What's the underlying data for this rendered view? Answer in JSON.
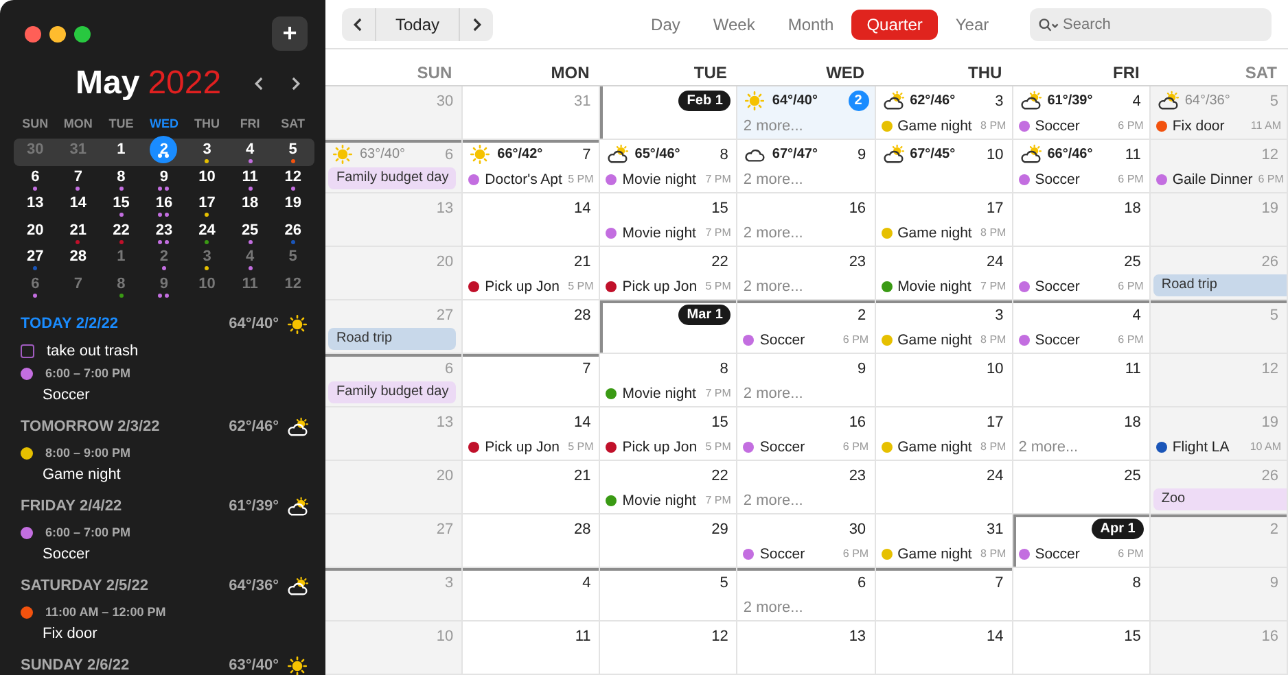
{
  "sidebar": {
    "add_button": "+",
    "month": "May",
    "year": "2022",
    "weekdays": [
      {
        "label": "SUN",
        "selected": false
      },
      {
        "label": "MON",
        "selected": false
      },
      {
        "label": "TUE",
        "selected": false
      },
      {
        "label": "WED",
        "selected": true
      },
      {
        "label": "THU",
        "selected": false
      },
      {
        "label": "FRI",
        "selected": false
      },
      {
        "label": "SAT",
        "selected": false
      }
    ],
    "weeks": [
      {
        "selected": true,
        "days": [
          {
            "day": "30",
            "dim": true,
            "selected": false
          },
          {
            "day": "31",
            "dim": true,
            "selected": false
          },
          {
            "day": "1",
            "dim": false,
            "selected": false
          },
          {
            "day": "2",
            "dim": false,
            "selected": true,
            "dots": [
              {
                "color": "#ffffff"
              },
              {
                "color": "#ffffff"
              }
            ]
          },
          {
            "day": "3",
            "dim": false,
            "selected": false,
            "dots": [
              {
                "color": "#e6c000"
              }
            ]
          },
          {
            "day": "4",
            "dim": false,
            "selected": false,
            "dots": [
              {
                "color": "#c36ee0"
              }
            ]
          },
          {
            "day": "5",
            "dim": false,
            "selected": false,
            "dots": [
              {
                "color": "#f2520e"
              }
            ]
          }
        ]
      },
      {
        "selected": false,
        "days": [
          {
            "day": "6",
            "dim": false,
            "selected": false,
            "dots": [
              {
                "color": "#c36ee0"
              }
            ]
          },
          {
            "day": "7",
            "dim": false,
            "selected": false,
            "dots": [
              {
                "color": "#c36ee0"
              }
            ]
          },
          {
            "day": "8",
            "dim": false,
            "selected": false,
            "dots": [
              {
                "color": "#c36ee0"
              }
            ]
          },
          {
            "day": "9",
            "dim": false,
            "selected": false,
            "dots": [
              {
                "color": "#c36ee0"
              },
              {
                "color": "#c36ee0"
              }
            ]
          },
          {
            "day": "10",
            "dim": false,
            "selected": false
          },
          {
            "day": "11",
            "dim": false,
            "selected": false,
            "dots": [
              {
                "color": "#c36ee0"
              }
            ]
          },
          {
            "day": "12",
            "dim": false,
            "selected": false,
            "dots": [
              {
                "color": "#c36ee0"
              }
            ]
          }
        ]
      },
      {
        "selected": false,
        "days": [
          {
            "day": "13",
            "dim": false,
            "selected": false
          },
          {
            "day": "14",
            "dim": false,
            "selected": false
          },
          {
            "day": "15",
            "dim": false,
            "selected": false,
            "dots": [
              {
                "color": "#c36ee0"
              }
            ]
          },
          {
            "day": "16",
            "dim": false,
            "selected": false,
            "dots": [
              {
                "color": "#c36ee0"
              },
              {
                "color": "#c36ee0"
              }
            ]
          },
          {
            "day": "17",
            "dim": false,
            "selected": false,
            "dots": [
              {
                "color": "#e6c000"
              }
            ]
          },
          {
            "day": "18",
            "dim": false,
            "selected": false
          },
          {
            "day": "19",
            "dim": false,
            "selected": false
          }
        ]
      },
      {
        "selected": false,
        "days": [
          {
            "day": "20",
            "dim": false,
            "selected": false
          },
          {
            "day": "21",
            "dim": false,
            "selected": false,
            "dots": [
              {
                "color": "#c0102a"
              }
            ]
          },
          {
            "day": "22",
            "dim": false,
            "selected": false,
            "dots": [
              {
                "color": "#c0102a"
              }
            ]
          },
          {
            "day": "23",
            "dim": false,
            "selected": false,
            "dots": [
              {
                "color": "#c36ee0"
              },
              {
                "color": "#c36ee0"
              }
            ]
          },
          {
            "day": "24",
            "dim": false,
            "selected": false,
            "dots": [
              {
                "color": "#3a9a14"
              }
            ]
          },
          {
            "day": "25",
            "dim": false,
            "selected": false,
            "dots": [
              {
                "color": "#c36ee0"
              }
            ]
          },
          {
            "day": "26",
            "dim": false,
            "selected": false,
            "dots": [
              {
                "color": "#1a55b8"
              }
            ]
          }
        ]
      },
      {
        "selected": false,
        "days": [
          {
            "day": "27",
            "dim": false,
            "selected": false,
            "dots": [
              {
                "color": "#1a55b8"
              }
            ]
          },
          {
            "day": "28",
            "dim": false,
            "selected": false
          },
          {
            "day": "1",
            "dim": true,
            "selected": false
          },
          {
            "day": "2",
            "dim": true,
            "selected": false,
            "dots": [
              {
                "color": "#c36ee0"
              }
            ]
          },
          {
            "day": "3",
            "dim": true,
            "selected": false,
            "dots": [
              {
                "color": "#e6c000"
              }
            ]
          },
          {
            "day": "4",
            "dim": true,
            "selected": false,
            "dots": [
              {
                "color": "#c36ee0"
              }
            ]
          },
          {
            "day": "5",
            "dim": true,
            "selected": false
          }
        ]
      },
      {
        "selected": false,
        "days": [
          {
            "day": "6",
            "dim": true,
            "selected": false,
            "dots": [
              {
                "color": "#c36ee0"
              }
            ]
          },
          {
            "day": "7",
            "dim": true,
            "selected": false
          },
          {
            "day": "8",
            "dim": true,
            "selected": false,
            "dots": [
              {
                "color": "#3a9a14"
              }
            ]
          },
          {
            "day": "9",
            "dim": true,
            "selected": false,
            "dots": [
              {
                "color": "#c36ee0"
              },
              {
                "color": "#c36ee0"
              }
            ]
          },
          {
            "day": "10",
            "dim": true,
            "selected": false
          },
          {
            "day": "11",
            "dim": true,
            "selected": false
          },
          {
            "day": "12",
            "dim": true,
            "selected": false
          }
        ]
      }
    ],
    "agenda": [
      {
        "label": "TODAY",
        "date": "2/2/22",
        "today": true,
        "weather": {
          "kind": "sun",
          "temp": "64°/40°"
        },
        "items": [
          {
            "kind": "task",
            "title": "take out trash",
            "checked": false
          },
          {
            "kind": "event",
            "time": "6:00 – 7:00 PM",
            "title": "Soccer",
            "color": "#c36ee0"
          }
        ]
      },
      {
        "label": "TOMORROW",
        "date": "2/3/22",
        "today": false,
        "weather": {
          "kind": "cloud-sun",
          "temp": "62°/46°"
        },
        "items": [
          {
            "kind": "event",
            "time": "8:00 – 9:00 PM",
            "title": "Game night",
            "color": "#e6c000"
          }
        ]
      },
      {
        "label": "FRIDAY",
        "date": "2/4/22",
        "today": false,
        "weather": {
          "kind": "cloud-sun",
          "temp": "61°/39°"
        },
        "items": [
          {
            "kind": "event",
            "time": "6:00 – 7:00 PM",
            "title": "Soccer",
            "color": "#c36ee0"
          }
        ]
      },
      {
        "label": "SATURDAY",
        "date": "2/5/22",
        "today": false,
        "weather": {
          "kind": "cloud-sun",
          "temp": "64°/36°"
        },
        "items": [
          {
            "kind": "event",
            "time": "11:00 AM – 12:00 PM",
            "title": "Fix door",
            "color": "#f2520e"
          }
        ]
      },
      {
        "label": "SUNDAY",
        "date": "2/6/22",
        "today": false,
        "weather": {
          "kind": "sun",
          "temp": "63°/40°"
        }
      }
    ]
  },
  "toolbar": {
    "today_button": "Today",
    "views": [
      {
        "label": "Day",
        "selected": false
      },
      {
        "label": "Week",
        "selected": false
      },
      {
        "label": "Month",
        "selected": false
      },
      {
        "label": "Quarter",
        "selected": true
      },
      {
        "label": "Year",
        "selected": false
      }
    ],
    "search": {
      "placeholder": "Search"
    }
  },
  "calendar": {
    "weekdays": [
      "SUN",
      "MON",
      "TUE",
      "WED",
      "THU",
      "FRI",
      "SAT"
    ],
    "weeks": [
      [
        {
          "day": "30",
          "dimmed": true
        },
        {
          "day": "31",
          "dimmed": true
        },
        {
          "badge": "Feb 1"
        },
        {
          "day": "2",
          "today": true,
          "weather": {
            "kind": "sun",
            "temp": "64°/40°"
          },
          "events": [
            {
              "kind": "more",
              "title": "2 more..."
            }
          ]
        },
        {
          "day": "3",
          "weather": {
            "kind": "cloud-sun",
            "temp": "62°/46°"
          },
          "events": [
            {
              "kind": "timed",
              "title": "Game night",
              "time": "8 PM",
              "color": "#e6c000"
            }
          ]
        },
        {
          "day": "4",
          "weather": {
            "kind": "cloud-sun",
            "temp": "61°/39°"
          },
          "events": [
            {
              "kind": "timed",
              "title": "Soccer",
              "time": "6 PM",
              "color": "#c36ee0"
            }
          ]
        },
        {
          "day": "5",
          "weather": {
            "kind": "cloud-sun",
            "temp": "64°/36°"
          },
          "events": [
            {
              "kind": "timed",
              "title": "Fix door",
              "time": "11 AM",
              "color": "#f2520e"
            }
          ]
        }
      ],
      [
        {
          "day": "6",
          "weather": {
            "kind": "sun",
            "temp": "63°/40°"
          },
          "events": [
            {
              "kind": "allday",
              "title": "Family budget day",
              "color": "#ecdaf5"
            }
          ]
        },
        {
          "day": "7",
          "weather": {
            "kind": "sun",
            "temp": "66°/42°"
          },
          "events": [
            {
              "kind": "timed",
              "title": "Doctor's Apt",
              "time": "5 PM",
              "color": "#c36ee0"
            }
          ]
        },
        {
          "day": "8",
          "weather": {
            "kind": "cloud-sun",
            "temp": "65°/46°"
          },
          "events": [
            {
              "kind": "timed",
              "title": "Movie night",
              "time": "7 PM",
              "color": "#c36ee0"
            }
          ]
        },
        {
          "day": "9",
          "weather": {
            "kind": "cloud",
            "temp": "67°/47°"
          },
          "events": [
            {
              "kind": "more",
              "title": "2 more..."
            }
          ]
        },
        {
          "day": "10",
          "weather": {
            "kind": "cloud-sun",
            "temp": "67°/45°"
          }
        },
        {
          "day": "11",
          "weather": {
            "kind": "cloud-sun",
            "temp": "66°/46°"
          },
          "events": [
            {
              "kind": "timed",
              "title": "Soccer",
              "time": "6 PM",
              "color": "#c36ee0"
            }
          ]
        },
        {
          "day": "12",
          "events": [
            {
              "kind": "timed",
              "title": "Gaile Dinner",
              "time": "6 PM",
              "color": "#c36ee0"
            }
          ]
        }
      ],
      [
        {
          "day": "13"
        },
        {
          "day": "14"
        },
        {
          "day": "15",
          "events": [
            {
              "kind": "timed",
              "title": "Movie night",
              "time": "7 PM",
              "color": "#c36ee0"
            }
          ]
        },
        {
          "day": "16",
          "events": [
            {
              "kind": "more",
              "title": "2 more..."
            }
          ]
        },
        {
          "day": "17",
          "events": [
            {
              "kind": "timed",
              "title": "Game night",
              "time": "8 PM",
              "color": "#e6c000"
            }
          ]
        },
        {
          "day": "18"
        },
        {
          "day": "19"
        }
      ],
      [
        {
          "day": "20"
        },
        {
          "day": "21",
          "events": [
            {
              "kind": "timed",
              "title": "Pick up Jon",
              "time": "5 PM",
              "color": "#c0102a"
            }
          ]
        },
        {
          "day": "22",
          "events": [
            {
              "kind": "timed",
              "title": "Pick up Jon",
              "time": "5 PM",
              "color": "#c0102a"
            }
          ]
        },
        {
          "day": "23",
          "events": [
            {
              "kind": "more",
              "title": "2 more..."
            }
          ]
        },
        {
          "day": "24",
          "events": [
            {
              "kind": "timed",
              "title": "Movie night",
              "time": "7 PM",
              "color": "#3a9a14"
            }
          ]
        },
        {
          "day": "25",
          "events": [
            {
              "kind": "timed",
              "title": "Soccer",
              "time": "6 PM",
              "color": "#c36ee0"
            }
          ]
        },
        {
          "day": "26",
          "events": [
            {
              "kind": "allday",
              "title": "Road trip",
              "color": "#c8d8ea"
            }
          ]
        }
      ],
      [
        {
          "day": "27",
          "events": [
            {
              "kind": "allday",
              "title": "Road trip",
              "color": "#c8d8ea"
            }
          ]
        },
        {
          "day": "28"
        },
        {
          "badge": "Mar 1"
        },
        {
          "day": "2",
          "events": [
            {
              "kind": "timed",
              "title": "Soccer",
              "time": "6 PM",
              "color": "#c36ee0"
            }
          ]
        },
        {
          "day": "3",
          "events": [
            {
              "kind": "timed",
              "title": "Game night",
              "time": "8 PM",
              "color": "#e6c000"
            }
          ]
        },
        {
          "day": "4",
          "events": [
            {
              "kind": "timed",
              "title": "Soccer",
              "time": "6 PM",
              "color": "#c36ee0"
            }
          ]
        },
        {
          "day": "5"
        }
      ],
      [
        {
          "day": "6",
          "events": [
            {
              "kind": "allday",
              "title": "Family budget day",
              "color": "#ecdaf5"
            }
          ]
        },
        {
          "day": "7"
        },
        {
          "day": "8",
          "events": [
            {
              "kind": "timed",
              "title": "Movie night",
              "time": "7 PM",
              "color": "#3a9a14"
            }
          ]
        },
        {
          "day": "9",
          "events": [
            {
              "kind": "more",
              "title": "2 more..."
            }
          ]
        },
        {
          "day": "10"
        },
        {
          "day": "11"
        },
        {
          "day": "12"
        }
      ],
      [
        {
          "day": "13"
        },
        {
          "day": "14",
          "events": [
            {
              "kind": "timed",
              "title": "Pick up Jon",
              "time": "5 PM",
              "color": "#c0102a"
            }
          ]
        },
        {
          "day": "15",
          "events": [
            {
              "kind": "timed",
              "title": "Pick up Jon",
              "time": "5 PM",
              "color": "#c0102a"
            }
          ]
        },
        {
          "day": "16",
          "events": [
            {
              "kind": "timed",
              "title": "Soccer",
              "time": "6 PM",
              "color": "#c36ee0"
            }
          ]
        },
        {
          "day": "17",
          "events": [
            {
              "kind": "timed",
              "title": "Game night",
              "time": "8 PM",
              "color": "#e6c000"
            }
          ]
        },
        {
          "day": "18",
          "events": [
            {
              "kind": "more",
              "title": "2 more..."
            }
          ]
        },
        {
          "day": "19",
          "events": [
            {
              "kind": "timed",
              "title": "Flight LA",
              "time": "10 AM",
              "color": "#1a55b8"
            }
          ]
        }
      ],
      [
        {
          "day": "20"
        },
        {
          "day": "21"
        },
        {
          "day": "22",
          "events": [
            {
              "kind": "timed",
              "title": "Movie night",
              "time": "7 PM",
              "color": "#3a9a14"
            }
          ]
        },
        {
          "day": "23",
          "events": [
            {
              "kind": "more",
              "title": "2 more..."
            }
          ]
        },
        {
          "day": "24"
        },
        {
          "day": "25"
        },
        {
          "day": "26",
          "events": [
            {
              "kind": "allday",
              "title": "Zoo",
              "color": "#eedcf6"
            }
          ]
        }
      ],
      [
        {
          "day": "27"
        },
        {
          "day": "28"
        },
        {
          "day": "29"
        },
        {
          "day": "30",
          "events": [
            {
              "kind": "timed",
              "title": "Soccer",
              "time": "6 PM",
              "color": "#c36ee0"
            }
          ]
        },
        {
          "day": "31",
          "events": [
            {
              "kind": "timed",
              "title": "Game night",
              "time": "8 PM",
              "color": "#e6c000"
            }
          ]
        },
        {
          "badge": "Apr 1",
          "events": [
            {
              "kind": "timed",
              "title": "Soccer",
              "time": "6 PM",
              "color": "#c36ee0"
            }
          ]
        },
        {
          "day": "2"
        }
      ],
      [
        {
          "day": "3"
        },
        {
          "day": "4"
        },
        {
          "day": "5"
        },
        {
          "day": "6",
          "events": [
            {
              "kind": "more",
              "title": "2 more..."
            }
          ]
        },
        {
          "day": "7"
        },
        {
          "day": "8"
        },
        {
          "day": "9"
        }
      ],
      [
        {
          "day": "10"
        },
        {
          "day": "11"
        },
        {
          "day": "12"
        },
        {
          "day": "13"
        },
        {
          "day": "14"
        },
        {
          "day": "15"
        },
        {
          "day": "16"
        }
      ]
    ]
  }
}
